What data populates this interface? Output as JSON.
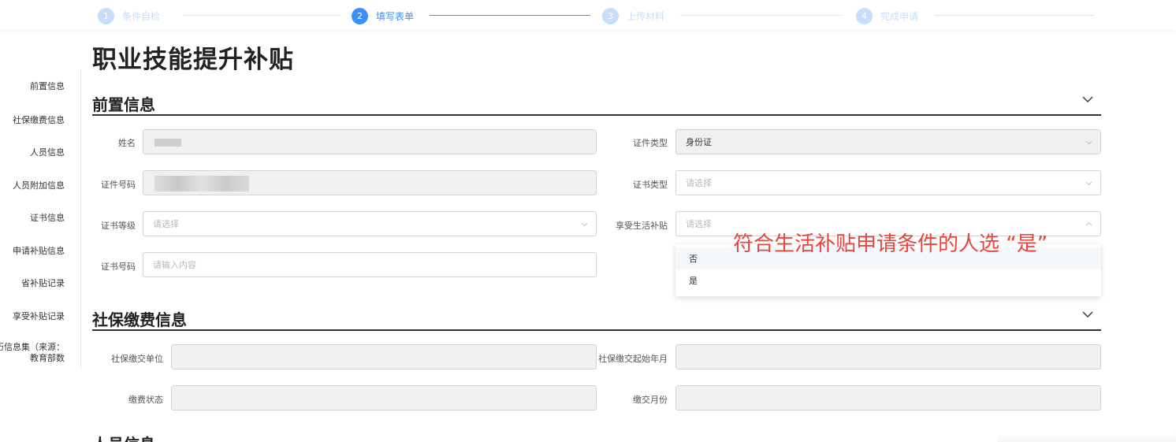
{
  "steps": [
    {
      "num": "1",
      "label": "条件自检"
    },
    {
      "num": "2",
      "label": "填写表单"
    },
    {
      "num": "3",
      "label": "上传材料"
    },
    {
      "num": "4",
      "label": "完成申请"
    }
  ],
  "active_step": 2,
  "page_title": "职业技能提升补贴",
  "sidenav": [
    "前置信息",
    "社保缴费信息",
    "人员信息",
    "人员附加信息",
    "证书信息",
    "申请补贴信息",
    "省补贴记录",
    "享受补贴记录",
    "学历信息集（来源：教育部数"
  ],
  "section_pre": {
    "title": "前置信息",
    "name_label": "姓名",
    "id_type_label": "证件类型",
    "id_type_value": "身份证",
    "id_no_label": "证件号码",
    "cert_type_label": "证书类型",
    "cert_type_placeholder": "请选择",
    "cert_level_label": "证书等级",
    "cert_level_placeholder": "请选择",
    "living_subsidy_label": "享受生活补贴",
    "living_subsidy_placeholder": "请选择",
    "cert_no_label": "证书号码",
    "cert_no_placeholder": "请输入内容",
    "dropdown_options": [
      "否",
      "是"
    ]
  },
  "annotation": "符合生活补贴申请条件的人选 “是”",
  "section_social": {
    "title": "社保缴费信息",
    "unit_label": "社保缴交单位",
    "start_label": "社保缴交起始年月",
    "status_label": "缴费状态",
    "months_label": "缴交月份"
  },
  "section_person": {
    "title": "人员信息"
  },
  "colors": {
    "accent": "#3d8ff5",
    "step_inactive": "#c8ddf8",
    "annotation": "#e8453c"
  }
}
